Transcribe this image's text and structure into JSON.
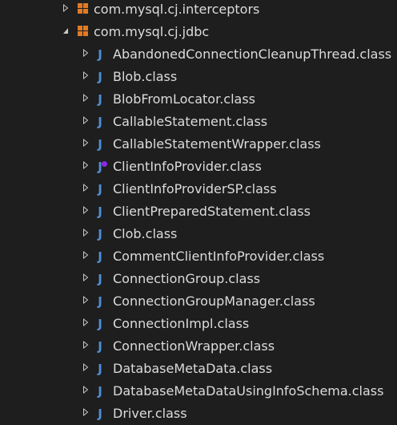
{
  "tree": {
    "packages": [
      {
        "label": "com.mysql.cj.interceptors",
        "expanded": false
      },
      {
        "label": "com.mysql.cj.jdbc",
        "expanded": true
      }
    ],
    "classes": [
      {
        "label": "AbandonedConnectionCleanupThread.class",
        "icon": "java-class-icon"
      },
      {
        "label": "Blob.class",
        "icon": "java-class-icon"
      },
      {
        "label": "BlobFromLocator.class",
        "icon": "java-class-icon"
      },
      {
        "label": "CallableStatement.class",
        "icon": "java-class-icon"
      },
      {
        "label": "CallableStatementWrapper.class",
        "icon": "java-class-icon"
      },
      {
        "label": "ClientInfoProvider.class",
        "icon": "java-interface-class-icon"
      },
      {
        "label": "ClientInfoProviderSP.class",
        "icon": "java-class-icon"
      },
      {
        "label": "ClientPreparedStatement.class",
        "icon": "java-class-icon"
      },
      {
        "label": "Clob.class",
        "icon": "java-class-icon"
      },
      {
        "label": "CommentClientInfoProvider.class",
        "icon": "java-class-icon"
      },
      {
        "label": "ConnectionGroup.class",
        "icon": "java-class-icon"
      },
      {
        "label": "ConnectionGroupManager.class",
        "icon": "java-class-icon"
      },
      {
        "label": "ConnectionImpl.class",
        "icon": "java-class-icon"
      },
      {
        "label": "ConnectionWrapper.class",
        "icon": "java-class-icon"
      },
      {
        "label": "DatabaseMetaData.class",
        "icon": "java-class-icon"
      },
      {
        "label": "DatabaseMetaDataUsingInfoSchema.class",
        "icon": "java-class-icon"
      },
      {
        "label": "Driver.class",
        "icon": "java-class-icon"
      }
    ]
  },
  "colors": {
    "background": "#1e1e1e",
    "text": "#dcdcdc",
    "package_icon": "#e07b24",
    "class_icon": "#4f8fd7",
    "interface_overlay": "#8a2be2",
    "arrow": "#c8c8c8"
  }
}
